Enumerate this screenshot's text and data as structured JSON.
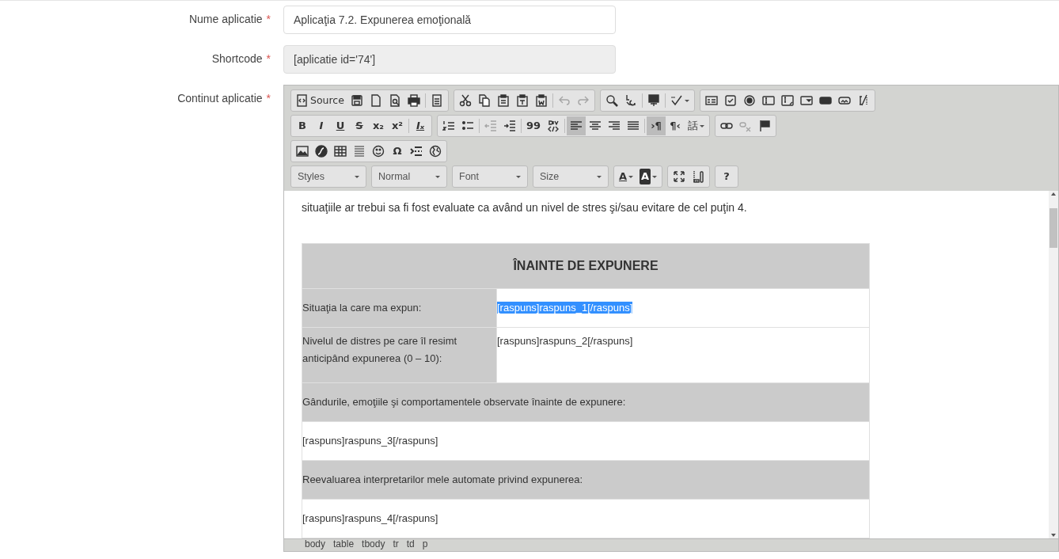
{
  "form": [
    {
      "label": "Nume aplicatie",
      "required_mark": "*",
      "kind": "input",
      "value": "Aplicaţia 7.2. Expunerea emoţională",
      "readonly": false
    },
    {
      "label": "Shortcode",
      "required_mark": "*",
      "kind": "input",
      "value": "[aplicatie id='74']",
      "readonly": true
    },
    {
      "label": "Continut aplicatie",
      "required_mark": "*",
      "kind": "editor"
    }
  ],
  "toolbar": [
    [
      [
        {
          "kind": "source",
          "text": "Source"
        },
        {
          "kind": "save"
        },
        {
          "kind": "new-page"
        },
        {
          "kind": "preview"
        },
        {
          "kind": "print"
        },
        {
          "sep": true,
          "kind": "templates"
        }
      ],
      [
        {
          "kind": "cut"
        },
        {
          "kind": "copy"
        },
        {
          "kind": "paste"
        },
        {
          "kind": "paste-text"
        },
        {
          "kind": "paste-word"
        },
        {
          "sep": true,
          "kind": "undo",
          "disabled": true
        },
        {
          "kind": "redo",
          "disabled": true
        }
      ],
      [
        {
          "kind": "find"
        },
        {
          "kind": "replace"
        },
        {
          "sep": true,
          "kind": "select-all"
        },
        {
          "sep": true,
          "kind": "spellcheck",
          "dropdown": true
        }
      ],
      [
        {
          "kind": "form"
        },
        {
          "kind": "check-field"
        },
        {
          "kind": "option-field"
        },
        {
          "kind": "text-field"
        },
        {
          "kind": "textarea"
        },
        {
          "kind": "select"
        },
        {
          "kind": "button"
        },
        {
          "kind": "image-button"
        },
        {
          "kind": "hidden-field"
        }
      ]
    ],
    [
      [
        {
          "kind": "bold",
          "text": "B"
        },
        {
          "kind": "italic",
          "text": "I"
        },
        {
          "kind": "underline",
          "text": "U"
        },
        {
          "kind": "strike",
          "text": "S"
        },
        {
          "kind": "subscript",
          "text": "x₂"
        },
        {
          "kind": "superscript",
          "text": "x²"
        },
        {
          "sep": true,
          "kind": "remove-format",
          "text": "Iₓ"
        }
      ],
      [
        {
          "kind": "numbered-list"
        },
        {
          "kind": "bulleted-list"
        },
        {
          "sep": true,
          "kind": "outdent",
          "disabled": true
        },
        {
          "kind": "indent"
        },
        {
          "sep": true,
          "kind": "blockquote",
          "text": "99"
        },
        {
          "kind": "div"
        },
        {
          "sep": true,
          "kind": "align-left",
          "selected": true
        },
        {
          "kind": "align-center",
          "selected": false
        },
        {
          "kind": "align-right",
          "selected": false
        },
        {
          "kind": "justify",
          "selected": false
        },
        {
          "sep": true,
          "kind": "ltr",
          "text": "›¶",
          "selected": true
        },
        {
          "kind": "rtl",
          "text": "¶‹",
          "selected": false
        },
        {
          "kind": "language",
          "text": "話",
          "dropdown": true
        }
      ],
      [
        {
          "kind": "link"
        },
        {
          "kind": "unlink",
          "disabled": true
        },
        {
          "kind": "flag"
        }
      ]
    ],
    [
      [
        {
          "kind": "image"
        },
        {
          "kind": "flash"
        },
        {
          "kind": "table"
        },
        {
          "kind": "horizontal-rule"
        },
        {
          "kind": "smiley"
        },
        {
          "kind": "special-char",
          "text": "Ω"
        },
        {
          "kind": "page-break"
        },
        {
          "kind": "globe"
        }
      ]
    ]
  ],
  "combos": [
    [
      {
        "text": "Styles"
      }
    ],
    [
      {
        "text": "Normal"
      }
    ],
    [
      {
        "text": "Font"
      }
    ],
    [
      {
        "text": "Size"
      }
    ]
  ],
  "combo_tools": [
    [
      {
        "kind": "text-color",
        "text": "A",
        "dropdown": true
      },
      {
        "kind": "bg-color",
        "text": "A",
        "dropdown": true
      }
    ],
    [
      {
        "kind": "maximize"
      },
      {
        "kind": "show-blocks"
      }
    ],
    [
      {
        "kind": "about",
        "text": "?"
      }
    ]
  ],
  "content": {
    "paragraph": "situaţiile ar trebui sa fi fost evaluate ca având un nivel de stres şi/sau evitare de cel puţin 4.",
    "table": {
      "header": "ÎNAINTE DE EXPUNERE",
      "rows": [
        {
          "kind": "pair",
          "label": "Situaţia la care ma expun:",
          "value": "[raspuns]raspuns_1[/raspuns]",
          "selected": true
        },
        {
          "kind": "pair",
          "label": "Nivelul de distres pe care îl resimt anticipând expunerea (0 – 10):",
          "value": "[raspuns]raspuns_2[/raspuns]",
          "selected": false
        },
        {
          "kind": "heading",
          "text": "Gândurile, emoţiile şi comportamentele observate înainte de expunere:"
        },
        {
          "kind": "answer",
          "text": "[raspuns]raspuns_3[/raspuns]"
        },
        {
          "kind": "heading",
          "text": "Reevaluarea interpretarilor mele automate privind expunerea:"
        },
        {
          "kind": "answer",
          "text": "[raspuns]raspuns_4[/raspuns]"
        }
      ]
    }
  },
  "status_path": [
    "body",
    "table",
    "tbody",
    "tr",
    "td",
    "p"
  ]
}
